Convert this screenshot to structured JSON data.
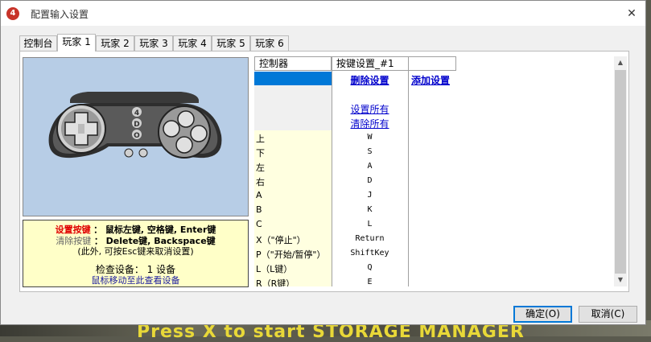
{
  "window": {
    "title": "配置输入设置",
    "app_icon_glyph": "4",
    "close_glyph": "✕"
  },
  "tabs": [
    {
      "label": "控制台"
    },
    {
      "label": "玩家 1"
    },
    {
      "label": "玩家 2"
    },
    {
      "label": "玩家 3"
    },
    {
      "label": "玩家 4"
    },
    {
      "label": "玩家 5"
    },
    {
      "label": "玩家 6"
    }
  ],
  "gamepad": {
    "label_top": "4",
    "label_mid": "D",
    "label_bot": "O"
  },
  "info": {
    "set_key_label": "设置按键",
    "set_key_value": "：  鼠标左键, 空格键, Enter键",
    "clear_key_label": "清除按键",
    "clear_key_value": "：  Delete键, Backspace键",
    "esc_note": "(此外, 可按Esc键来取消设置)",
    "check_device": "检查设备：  1 设备",
    "hover_hint": "鼠标移动至此查看设备"
  },
  "table": {
    "headers": [
      "控制器",
      "按键设置_#1"
    ],
    "delete_link": "删除设置",
    "add_link": "添加设置",
    "set_all_link": "设置所有",
    "clear_all_link": "清除所有",
    "rows": [
      {
        "label": "上",
        "key": "W"
      },
      {
        "label": "下",
        "key": "S"
      },
      {
        "label": "左",
        "key": "A"
      },
      {
        "label": "右",
        "key": "D"
      },
      {
        "label": "A",
        "key": "J"
      },
      {
        "label": "B",
        "key": "K"
      },
      {
        "label": "C",
        "key": "L"
      },
      {
        "label": "X（\"停止\"）",
        "key": "Return"
      },
      {
        "label": "P（\"开始/暂停\"）",
        "key": "ShiftKey"
      },
      {
        "label": "L（L键）",
        "key": "Q"
      },
      {
        "label": "R（R键）",
        "key": "E"
      }
    ]
  },
  "buttons": {
    "ok": "确定(O)",
    "cancel": "取消(C)"
  },
  "background": {
    "text": "Press X to start STORAGE MANAGER"
  },
  "colors": {
    "accent": "#0078d7",
    "info_bg": "#ffffc8",
    "gamepad_bg": "#b7cde6",
    "set_key_color": "#e00000"
  }
}
